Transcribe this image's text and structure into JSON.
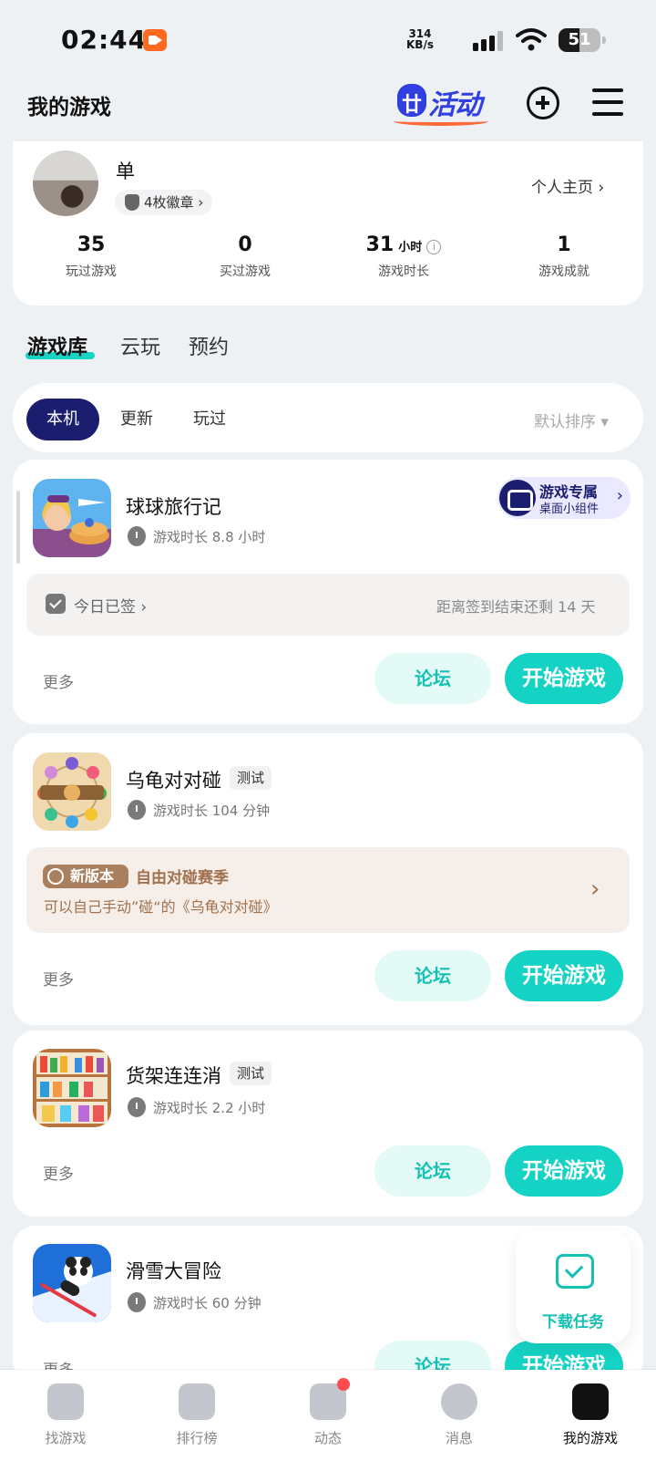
{
  "status_bar": {
    "time": "02:44",
    "net_speed_value": "314",
    "net_speed_unit": "KB/s",
    "battery": "51"
  },
  "header": {
    "title": "我的游戏",
    "activity_label": "活动"
  },
  "profile": {
    "name": "单",
    "badges": "4枚徽章 ›",
    "homepage_link": "个人主页 ›",
    "stats": [
      {
        "value": "35",
        "unit": "",
        "label": "玩过游戏"
      },
      {
        "value": "0",
        "unit": "",
        "label": "买过游戏"
      },
      {
        "value": "31",
        "unit": "小时",
        "label": "游戏时长"
      },
      {
        "value": "1",
        "unit": "",
        "label": "游戏成就"
      }
    ]
  },
  "main_tabs": [
    "游戏库",
    "云玩",
    "预约"
  ],
  "filters": {
    "chips": [
      "本机",
      "更新",
      "玩过"
    ],
    "sort": "默认排序 ▾"
  },
  "games": [
    {
      "name": "球球旅行记",
      "tag": "",
      "playtime": "游戏时长 8.8 小时",
      "widget_title": "游戏专属",
      "widget_sub": "桌面小组件",
      "checkin_status": "今日已签 ›",
      "checkin_remaining": "距离签到结束还剩 14 天",
      "more": "更多",
      "forum": "论坛",
      "start": "开始游戏"
    },
    {
      "name": "乌龟对对碰",
      "tag": "测试",
      "playtime": "游戏时长 104 分钟",
      "newver_tag": "新版本",
      "news_title": "自由对碰赛季",
      "news_body": "可以自己手动”碰“的《乌龟对对碰》",
      "more": "更多",
      "forum": "论坛",
      "start": "开始游戏"
    },
    {
      "name": "货架连连消",
      "tag": "测试",
      "playtime": "游戏时长 2.2 小时",
      "more": "更多",
      "forum": "论坛",
      "start": "开始游戏"
    },
    {
      "name": "滑雪大冒险",
      "tag": "",
      "playtime": "游戏时长 60 分钟",
      "more": "更多",
      "forum": "论坛",
      "start": "开始游戏"
    }
  ],
  "download_float": {
    "label": "下载任务"
  },
  "bottom_nav": [
    "找游戏",
    "排行榜",
    "动态",
    "消息",
    "我的游戏"
  ],
  "colors": {
    "accent": "#14d3c4",
    "navy": "#1b1e6e",
    "activity_blue": "#2f3fe0",
    "news_brown": "#a0714e"
  }
}
